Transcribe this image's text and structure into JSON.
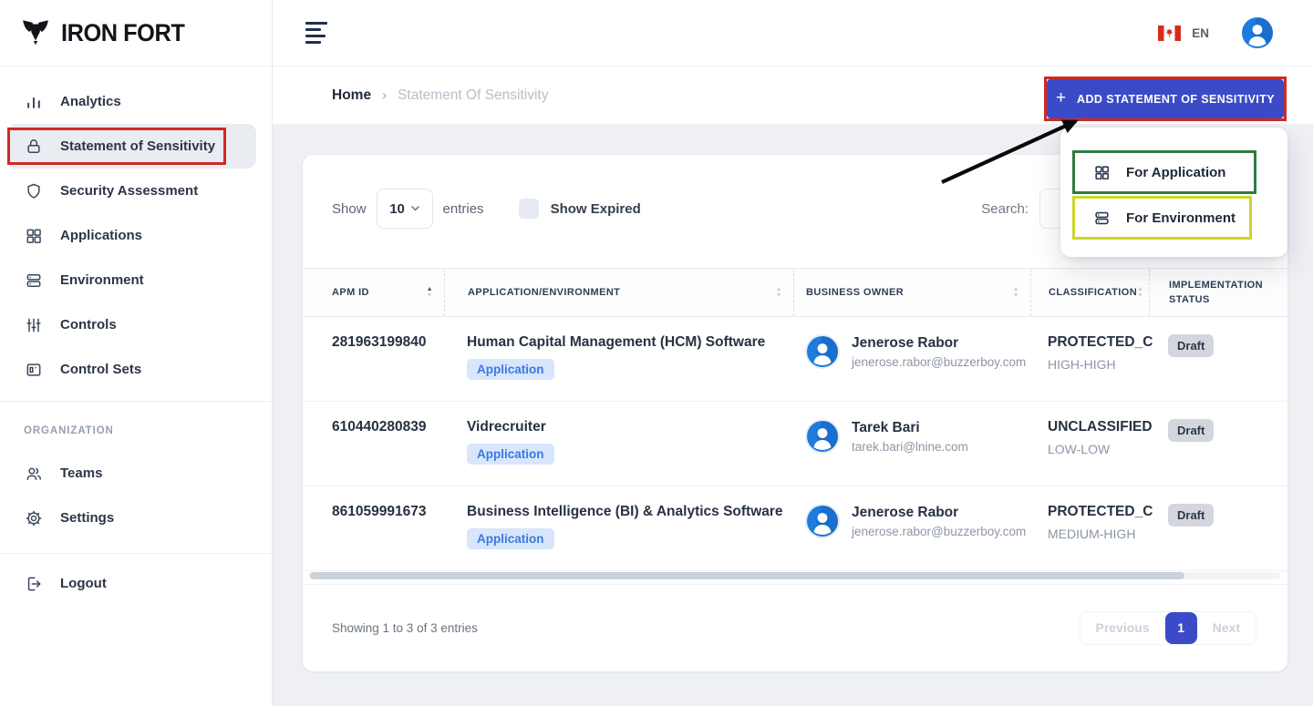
{
  "brand": {
    "name": "IRON FORT"
  },
  "topbar": {
    "language": "EN"
  },
  "sidebar": {
    "items": [
      {
        "label": "Analytics",
        "icon": "bar-chart-icon",
        "active": false
      },
      {
        "label": "Statement of Sensitivity",
        "icon": "lock-icon",
        "active": true,
        "annotation": "red-box"
      },
      {
        "label": "Security Assessment",
        "icon": "shield-icon",
        "active": false
      },
      {
        "label": "Applications",
        "icon": "grid-icon",
        "active": false
      },
      {
        "label": "Environment",
        "icon": "server-icon",
        "active": false
      },
      {
        "label": "Controls",
        "icon": "sliders-icon",
        "active": false
      },
      {
        "label": "Control Sets",
        "icon": "card-icon",
        "active": false
      }
    ],
    "section_label": "ORGANIZATION",
    "org_items": [
      {
        "label": "Teams",
        "icon": "users-icon"
      },
      {
        "label": "Settings",
        "icon": "gear-icon"
      }
    ],
    "logout": {
      "label": "Logout",
      "icon": "logout-icon"
    }
  },
  "breadcrumb": {
    "home": "Home",
    "separator": "›",
    "current": "Statement Of Sensitivity"
  },
  "actions": {
    "add_button": {
      "plus": "+",
      "label": "ADD STATEMENT OF SENSITIVITY",
      "annotation": "red-box"
    },
    "dropdown": {
      "items": [
        {
          "label": "For Application",
          "icon": "grid-icon",
          "annotation": "green-box"
        },
        {
          "label": "For Environment",
          "icon": "server-icon",
          "annotation": "yellow-box"
        }
      ]
    }
  },
  "table_controls": {
    "show_label": "Show",
    "page_size": "10",
    "entries_label": "entries",
    "show_expired_label": "Show Expired",
    "expired_checked": false,
    "search_label": "Search:",
    "search_value": ""
  },
  "table": {
    "columns": [
      {
        "label": "APM ID",
        "sort": "asc"
      },
      {
        "label": "APPLICATION/ENVIRONMENT",
        "sort": "none"
      },
      {
        "label": "BUSINESS OWNER",
        "sort": "none"
      },
      {
        "label": "CLASSIFICATION",
        "sort": "none"
      },
      {
        "label": "IMPLEMENTATION STATUS",
        "sort": "none"
      }
    ],
    "rows": [
      {
        "apm_id": "281963199840",
        "name": "Human Capital Management (HCM) Software",
        "type_badge": "Application",
        "owner_name": "Jenerose Rabor",
        "owner_email": "jenerose.rabor@buzzerboy.com",
        "classification": "PROTECTED_C",
        "classification_level": "HIGH-HIGH",
        "status": "Draft"
      },
      {
        "apm_id": "610440280839",
        "name": "Vidrecruiter",
        "type_badge": "Application",
        "owner_name": "Tarek Bari",
        "owner_email": "tarek.bari@lnine.com",
        "classification": "UNCLASSIFIED",
        "classification_level": "LOW-LOW",
        "status": "Draft"
      },
      {
        "apm_id": "861059991673",
        "name": "Business Intelligence (BI) & Analytics Software",
        "type_badge": "Application",
        "owner_name": "Jenerose Rabor",
        "owner_email": "jenerose.rabor@buzzerboy.com",
        "classification": "PROTECTED_C",
        "classification_level": "MEDIUM-HIGH",
        "status": "Draft"
      }
    ]
  },
  "footer": {
    "summary": "Showing 1 to 3 of 3 entries",
    "pagination": {
      "previous": "Previous",
      "current_page": "1",
      "next": "Next"
    }
  },
  "colors": {
    "primary_blue": "#3b4bc8",
    "annotation_red": "#ce2b25",
    "annotation_green": "#2e7d40",
    "annotation_yellow": "#cdd628",
    "badge_app_bg": "#d8e6fb",
    "badge_app_text": "#3c78e0",
    "status_badge_bg": "#d3d7dd",
    "avatar_blue": "#1e7be0",
    "flag_red": "#d52b1e"
  }
}
